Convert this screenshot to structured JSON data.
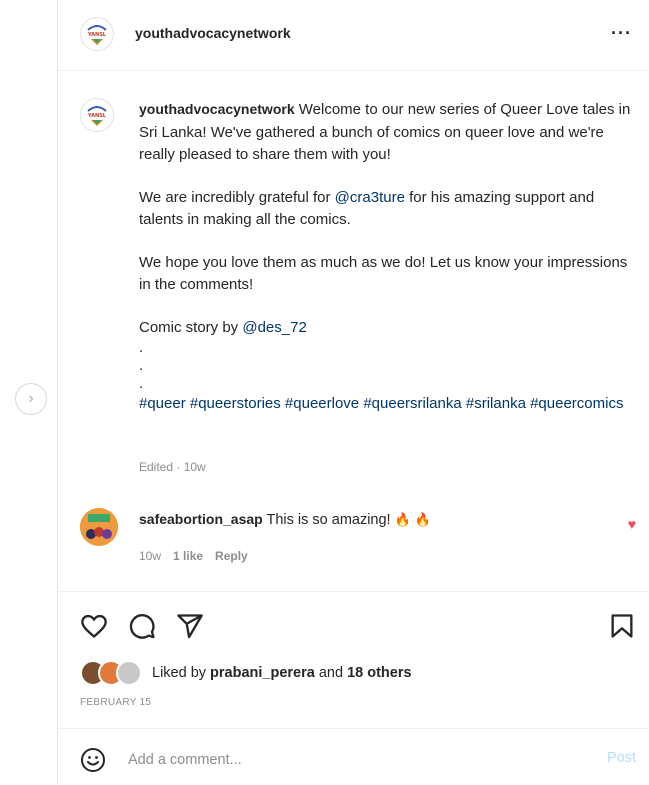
{
  "post": {
    "author": "youthadvocacynetwork",
    "more_label": "···",
    "caption": {
      "author": "youthadvocacynetwork",
      "p1": " Welcome to our new series of Queer Love tales in Sri Lanka! We've gathered a bunch of comics on queer love and we're really pleased to share them with you!",
      "p2_before": "We are incredibly grateful for ",
      "p2_mention": "@cra3ture",
      "p2_after": " for his amazing support and talents in making all the comics.",
      "p3": "We hope you love them as much as we do! Let us know your impressions in the comments!",
      "p4_before": "Comic story by ",
      "p4_mention": "@des_72",
      "dot": ".",
      "hashtags": "#queer #queerstories #queerlove #queersrilanka #srilanka #queercomics"
    },
    "edited": "Edited · 10w"
  },
  "comment": {
    "user": "safeabortion_asap",
    "text": " This is so amazing! ",
    "time": "10w",
    "likes": "1 like",
    "reply": "Reply"
  },
  "likes": {
    "prefix": "Liked by ",
    "user": "prabani_perera",
    "middle": " and ",
    "others": "18 others"
  },
  "date": "FEBRUARY 15",
  "comment_box": {
    "placeholder": "Add a comment...",
    "post_label": "Post"
  },
  "colors": {
    "link": "#00376b",
    "heart": "#ed4956",
    "post_disabled": "#b2dffc",
    "muted": "#8e8e8e"
  }
}
